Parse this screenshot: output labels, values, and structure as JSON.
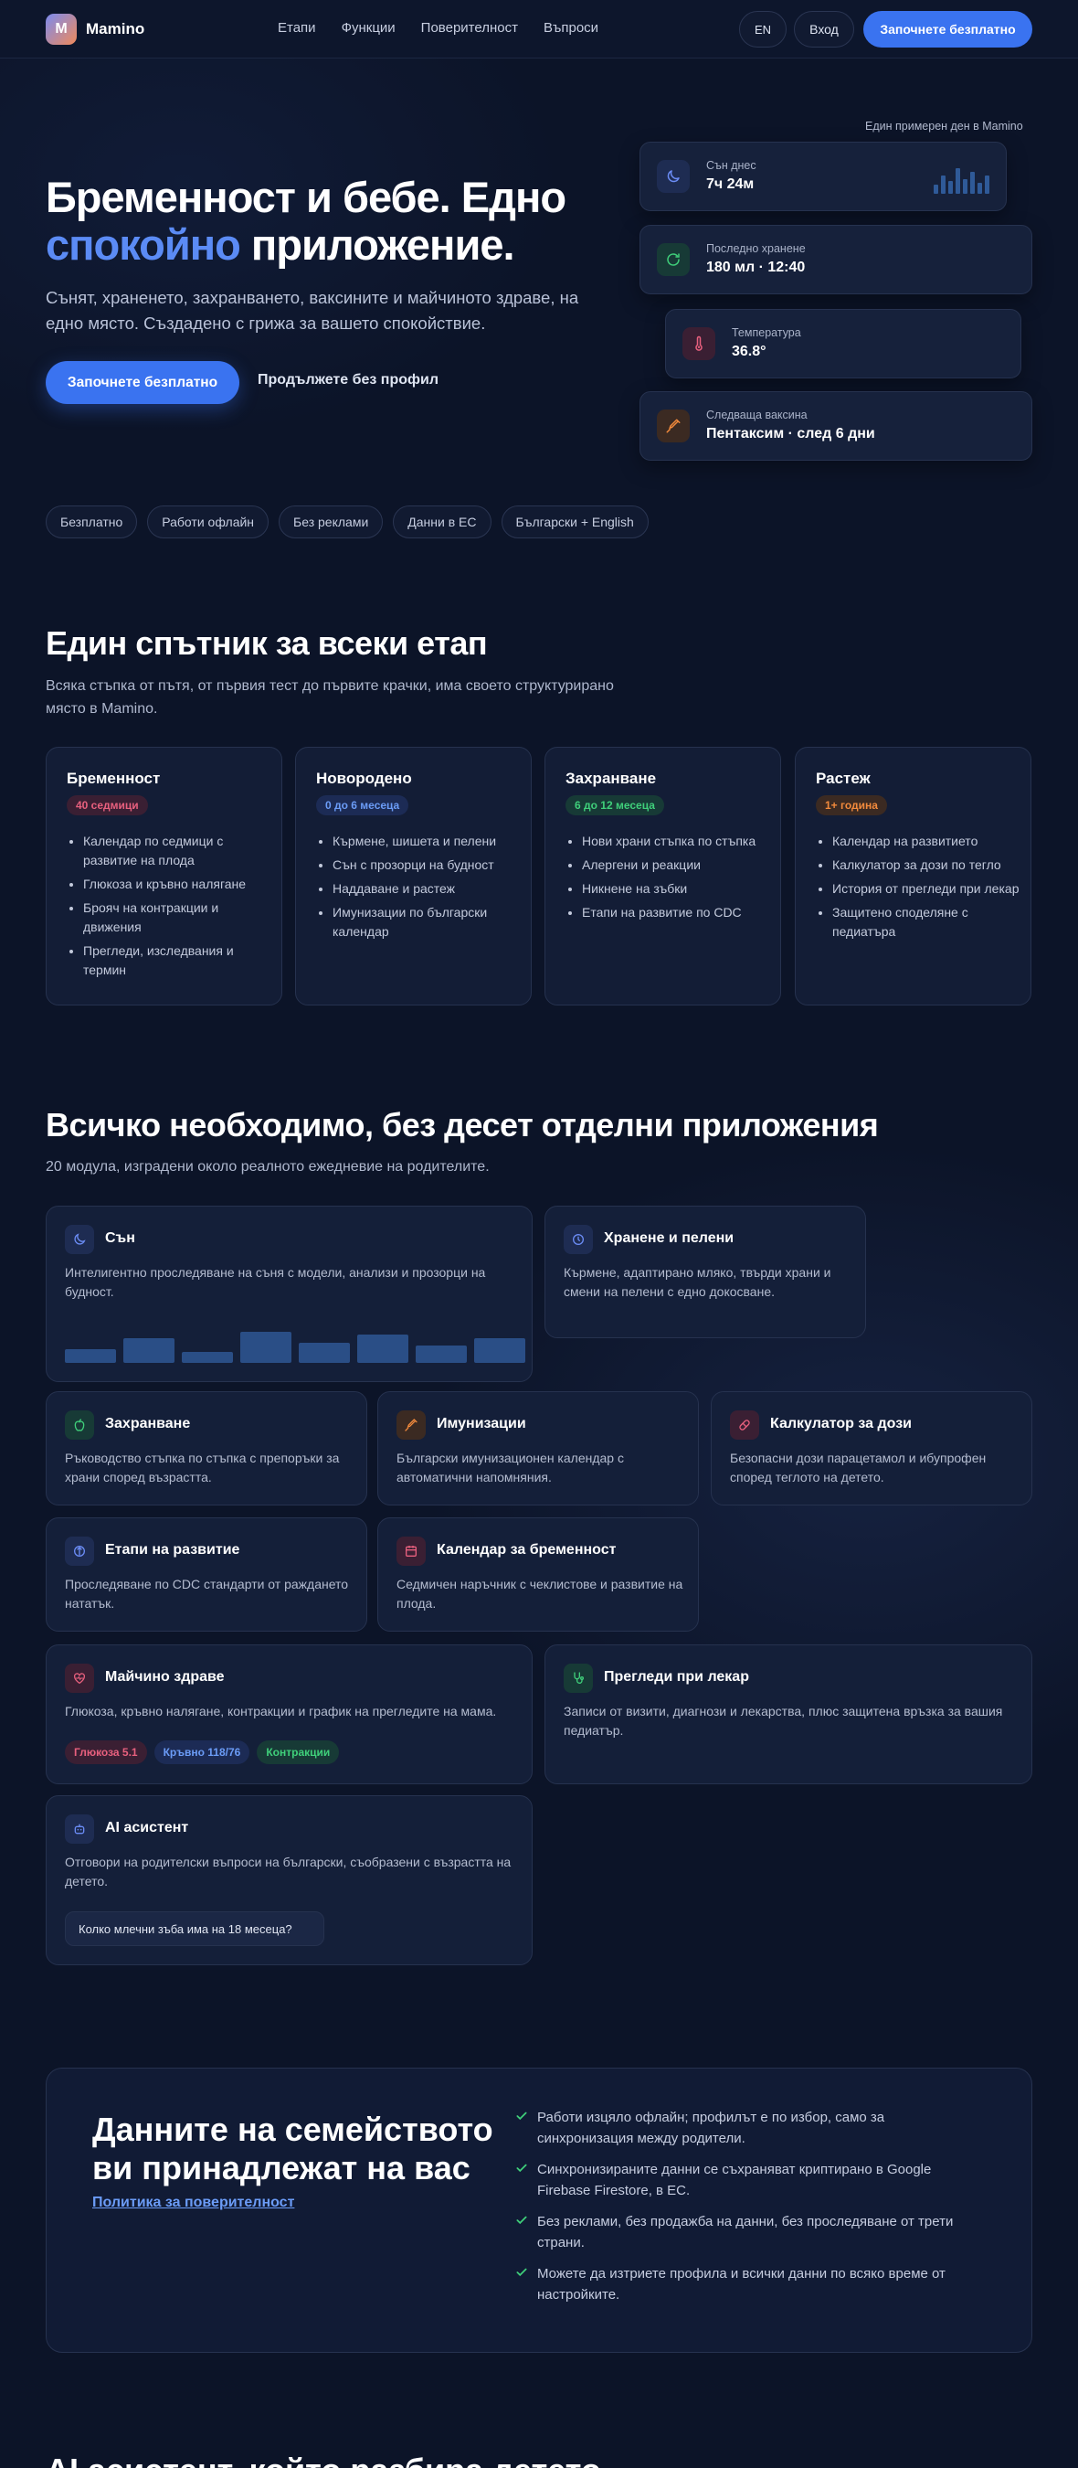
{
  "nav": {
    "brand": "Mamino",
    "logo_letter": "M",
    "links": [
      "Етапи",
      "Функции",
      "Поверителност",
      "Въпроси"
    ],
    "lang": "EN",
    "login": "Вход",
    "cta": "Започнете безплатно"
  },
  "hero": {
    "title_line1": "Бременност и бебе. Едно",
    "title_accent": "спокойно",
    "title_rest": " приложение.",
    "subtitle": "Сънят, храненето, захранването, ваксините и майчиното здраве, на едно място. Създадено с грижа за вашето спокойствие.",
    "primary_button": "Започнете безплатно",
    "ghost_button": "Продължете без профил",
    "example_label": "Един примерен ден в Mamino",
    "cards": [
      {
        "label": "Сън днес",
        "value": "7ч 24м",
        "icon": "moon-icon",
        "color": "#6b8cf5"
      },
      {
        "label": "Последно хранене",
        "value": "180 мл · 12:40",
        "icon": "refresh-icon",
        "color": "#3fcf7a"
      },
      {
        "label": "Температура",
        "value": "36.8°",
        "icon": "thermometer-icon",
        "color": "#e8607e"
      },
      {
        "label": "Следваща ваксина",
        "value": "Пентаксим · след 6 дни",
        "icon": "syringe-icon",
        "color": "#f28a3c"
      }
    ],
    "chips": [
      "Безплатно",
      "Работи офлайн",
      "Без реклами",
      "Данни в ЕС",
      "Български + English"
    ]
  },
  "stages": {
    "title": "Един спътник за всеки етап",
    "subtitle": "Всяка стъпка от пътя, от първия тест до първите крачки, има своето структурирано място в Mamino.",
    "items": [
      {
        "title": "Бременност",
        "badge": "40 седмици",
        "badge_color": "#e8607e",
        "points": [
          "Календар по седмици с развитие на плода",
          "Глюкоза и кръвно налягане",
          "Брояч на контракции и движения",
          "Прегледи, изследвания и термин"
        ]
      },
      {
        "title": "Новородено",
        "badge": "0 до 6 месеца",
        "badge_color": "#5b8bf5",
        "points": [
          "Кърмене, шишета и пелени",
          "Сън с прозорци на будност",
          "Наддаване и растеж",
          "Имунизации по български календар"
        ]
      },
      {
        "title": "Захранване",
        "badge": "6 до 12 месеца",
        "badge_color": "#3fcf7a",
        "points": [
          "Нови храни стъпка по стъпка",
          "Алергени и реакции",
          "Никнене на зъбки",
          "Етапи на развитие по CDC"
        ]
      },
      {
        "title": "Растеж",
        "badge": "1+ година",
        "badge_color": "#f28a3c",
        "points": [
          "Календар на развитието",
          "Калкулатор за дози по тегло",
          "История от прегледи при лекар",
          "Защитено споделяне с педиатъра"
        ]
      }
    ]
  },
  "features": {
    "title": "Всичко необходимо, без десет отделни приложения",
    "subtitle": "20 модула, изградени около реалното ежедневие на родителите.",
    "sleep": {
      "title": "Сън",
      "desc": "Интелигентно проследяване на съня с модели, анализи и прозорци на будност.",
      "bars": [
        0.45,
        0.8,
        0.35,
        1.0,
        0.65,
        0.9,
        0.55,
        0.8
      ]
    },
    "feeding": {
      "title": "Хранене и пелени",
      "desc": "Кърмене, адаптирано мляко, твърди храни и смени на пелени с едно докосване."
    },
    "solids": {
      "title": "Захранване",
      "desc": "Ръководство стъпка по стъпка с препоръки за храни според възрастта."
    },
    "immunizations": {
      "title": "Имунизации",
      "desc": "Български имунизационен календар с автоматични напомняния."
    },
    "dose": {
      "title": "Калкулатор за дози",
      "desc": "Безопасни дози парацетамол и ибупрофен според теглото на детето."
    },
    "milestones": {
      "title": "Етапи на развитие",
      "desc": "Проследяване по CDC стандарти от раждането нататък."
    },
    "pregcal": {
      "title": "Календар за бременност",
      "desc": "Седмичен наръчник с чеклистове и развитие на плода."
    },
    "maternal": {
      "title": "Майчино здраве",
      "desc": "Глюкоза, кръвно налягане, контракции и график на прегледите на мама.",
      "tags": [
        "Глюкоза 5.1",
        "Кръвно 118/76",
        "Контракции"
      ]
    },
    "doctor": {
      "title": "Прегледи при лекар",
      "desc": "Записи от визити, диагнози и лекарства, плюс защитена връзка за вашия педиатър."
    },
    "ai": {
      "title": "AI асистент",
      "desc": "Отговори на родителски въпроси на български, съобразени с възрастта на детето.",
      "question": "Колко млечни зъба има на 18 месеца?"
    }
  },
  "privacy": {
    "title": "Данните на семейството ви принадлежат на вас",
    "link": "Политика за поверителност",
    "points": [
      "Работи изцяло офлайн; профилът е по избор, само за синхронизация между родители.",
      "Синхронизираните данни се съхраняват криптирано в Google Firebase Firestore, в ЕС.",
      "Без реклами, без продажба на данни, без проследяване от трети страни.",
      "Можете да изтриете профила и всички данни по всяко време от настройките."
    ]
  },
  "next_heading": "AI асистент, който разбира детето"
}
